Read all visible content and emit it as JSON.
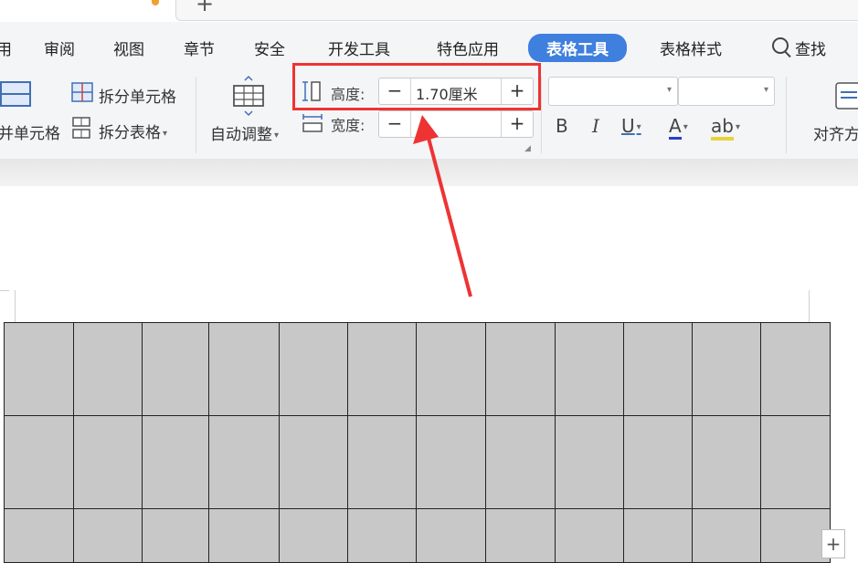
{
  "menu": {
    "items": [
      "用",
      "审阅",
      "视图",
      "章节",
      "安全",
      "开发工具",
      "特色应用",
      "表格工具",
      "表格样式"
    ],
    "active": "表格工具",
    "search_label": "查找"
  },
  "toolbar": {
    "merge_cells_label": "并单元格",
    "split_cell_label": "拆分单元格",
    "split_table_label": "拆分表格",
    "auto_fit_label": "自动调整",
    "height_label": "高度:",
    "height_value": "1.70厘米",
    "width_label": "宽度:",
    "width_value": "",
    "minus": "−",
    "plus": "+",
    "bold": "B",
    "italic": "I",
    "underline": "U",
    "font_color": "A",
    "highlight": "ab",
    "align_label": "对齐方"
  },
  "table": {
    "rows": 3,
    "col_widths": [
      75,
      74,
      72,
      76,
      74,
      74,
      75,
      75,
      74,
      74,
      74,
      75
    ],
    "row_heights": [
      101,
      101,
      58
    ]
  },
  "colors": {
    "accent": "#3f7fde",
    "highlight_box": "#ee3333",
    "arrow": "#ee3333",
    "cell_fill": "#c8c8c8"
  }
}
